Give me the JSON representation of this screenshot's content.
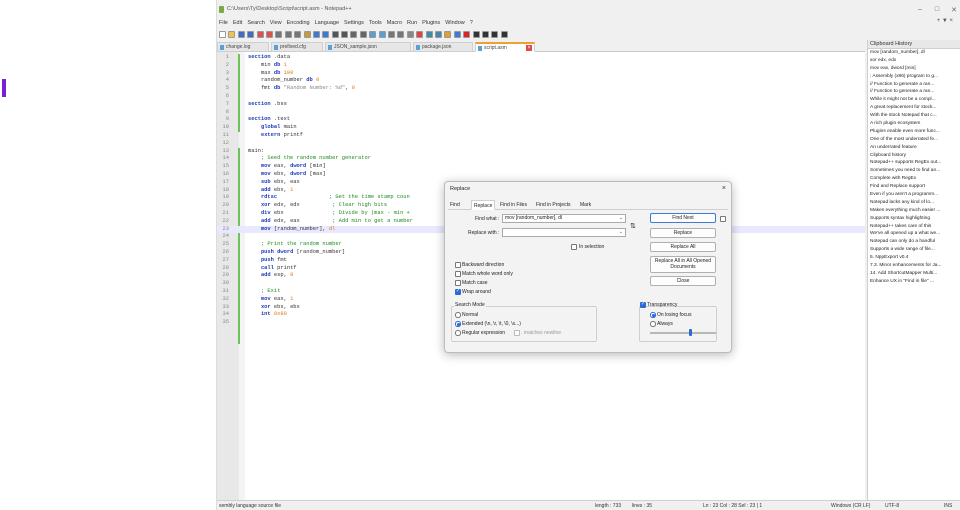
{
  "window": {
    "title": "C:\\Users\\Ty\\Desktop\\Script\\script.asm - Notepad++"
  },
  "menu": [
    "File",
    "Edit",
    "Search",
    "View",
    "Encoding",
    "Language",
    "Settings",
    "Tools",
    "Macro",
    "Run",
    "Plugins",
    "Window",
    "?"
  ],
  "menu_right": "+ ▼ ×",
  "toolbar_icons": [
    "new-icon",
    "open-icon",
    "save-icon",
    "save-all-icon",
    "close-icon",
    "close-all-icon",
    "print-icon",
    "cut-icon",
    "copy-icon",
    "paste-icon",
    "undo-icon",
    "redo-icon",
    "find-icon",
    "replace-icon",
    "zoom-in-icon",
    "zoom-out-icon",
    "sync-v-icon",
    "sync-h-icon",
    "wrap-icon",
    "all-chars-icon",
    "indent-guide-icon",
    "udl-icon",
    "doc-map-icon",
    "func-list-icon",
    "folder-icon",
    "monitor-icon",
    "record-icon",
    "stop-icon",
    "play-icon",
    "play-multi-icon",
    "save-macro-icon"
  ],
  "tabs": [
    {
      "label": "change.log"
    },
    {
      "label": "prefixed.cfg"
    },
    {
      "label": "JSON_sample.json"
    },
    {
      "label": "package.json"
    },
    {
      "label": "script.asm",
      "close": "×"
    }
  ],
  "code_lines": [
    {
      "n": "1",
      "t": [
        {
          "c": "kw",
          "v": "section"
        },
        {
          "c": "id",
          "v": " .data"
        }
      ]
    },
    {
      "n": "2",
      "t": [
        {
          "c": "id",
          "v": "    min "
        },
        {
          "c": "kw",
          "v": "db"
        },
        {
          "c": "num",
          "v": " 1"
        }
      ]
    },
    {
      "n": "3",
      "t": [
        {
          "c": "id",
          "v": "    max "
        },
        {
          "c": "kw",
          "v": "db"
        },
        {
          "c": "num",
          "v": " 100"
        }
      ]
    },
    {
      "n": "4",
      "t": [
        {
          "c": "id",
          "v": "    random_number "
        },
        {
          "c": "kw",
          "v": "db"
        },
        {
          "c": "num",
          "v": " 0"
        }
      ]
    },
    {
      "n": "5",
      "t": [
        {
          "c": "id",
          "v": "    fmt "
        },
        {
          "c": "kw",
          "v": "db"
        },
        {
          "c": "str",
          "v": " \"Random Number: %d\""
        },
        {
          "c": "id",
          "v": ", "
        },
        {
          "c": "num",
          "v": "0"
        }
      ]
    },
    {
      "n": "6",
      "t": []
    },
    {
      "n": "7",
      "t": [
        {
          "c": "kw",
          "v": "section"
        },
        {
          "c": "id",
          "v": " .bss"
        }
      ]
    },
    {
      "n": "8",
      "t": []
    },
    {
      "n": "9",
      "t": [
        {
          "c": "kw",
          "v": "section"
        },
        {
          "c": "id",
          "v": " .text"
        }
      ]
    },
    {
      "n": "10",
      "t": [
        {
          "c": "id",
          "v": "    "
        },
        {
          "c": "kw",
          "v": "global"
        },
        {
          "c": "id",
          "v": " main"
        }
      ]
    },
    {
      "n": "11",
      "t": [
        {
          "c": "id",
          "v": "    "
        },
        {
          "c": "kw",
          "v": "extern"
        },
        {
          "c": "id",
          "v": " printf"
        }
      ]
    },
    {
      "n": "12",
      "t": []
    },
    {
      "n": "13",
      "t": [
        {
          "c": "lbl",
          "v": "main:"
        }
      ]
    },
    {
      "n": "14",
      "t": [
        {
          "c": "cmt",
          "v": "    ; Seed the random number generator"
        }
      ]
    },
    {
      "n": "15",
      "t": [
        {
          "c": "ins",
          "v": "    mov"
        },
        {
          "c": "id",
          "v": " eax, "
        },
        {
          "c": "ins",
          "v": "dword"
        },
        {
          "c": "id",
          "v": " [min]"
        }
      ]
    },
    {
      "n": "16",
      "t": [
        {
          "c": "ins",
          "v": "    mov"
        },
        {
          "c": "id",
          "v": " ebx, "
        },
        {
          "c": "ins",
          "v": "dword"
        },
        {
          "c": "id",
          "v": " [max]"
        }
      ]
    },
    {
      "n": "17",
      "t": [
        {
          "c": "ins",
          "v": "    sub"
        },
        {
          "c": "id",
          "v": " ebx, eax"
        }
      ]
    },
    {
      "n": "18",
      "t": [
        {
          "c": "ins",
          "v": "    add"
        },
        {
          "c": "id",
          "v": " ebx, "
        },
        {
          "c": "num",
          "v": "1"
        }
      ]
    },
    {
      "n": "19",
      "t": [
        {
          "c": "ins",
          "v": "    rdtsc"
        },
        {
          "c": "cmt",
          "v": "                ; Get the time stamp coun"
        }
      ]
    },
    {
      "n": "20",
      "t": [
        {
          "c": "ins",
          "v": "    xor"
        },
        {
          "c": "id",
          "v": " edx, edx"
        },
        {
          "c": "cmt",
          "v": "          ; Clear high bits"
        }
      ]
    },
    {
      "n": "21",
      "t": [
        {
          "c": "ins",
          "v": "    div"
        },
        {
          "c": "id",
          "v": " ebx"
        },
        {
          "c": "cmt",
          "v": "               ; Divide by (max - min +"
        }
      ]
    },
    {
      "n": "22",
      "t": [
        {
          "c": "ins",
          "v": "    add"
        },
        {
          "c": "id",
          "v": " edx, eax"
        },
        {
          "c": "cmt",
          "v": "          ; Add min to get a number"
        }
      ]
    },
    {
      "n": "23",
      "hl": true,
      "t": [
        {
          "c": "ins",
          "v": "    mov"
        },
        {
          "c": "id",
          "v": " [random_number], "
        },
        {
          "c": "num",
          "v": "dl"
        }
      ]
    },
    {
      "n": "24",
      "t": []
    },
    {
      "n": "25",
      "t": [
        {
          "c": "cmt",
          "v": "    ; Print the random number"
        }
      ]
    },
    {
      "n": "26",
      "t": [
        {
          "c": "ins",
          "v": "    push"
        },
        {
          "c": "ins",
          "v": " dword"
        },
        {
          "c": "id",
          "v": " [random_number]"
        }
      ]
    },
    {
      "n": "27",
      "t": [
        {
          "c": "ins",
          "v": "    push"
        },
        {
          "c": "id",
          "v": " fmt"
        }
      ]
    },
    {
      "n": "28",
      "t": [
        {
          "c": "ins",
          "v": "    call"
        },
        {
          "c": "id",
          "v": " printf"
        }
      ]
    },
    {
      "n": "29",
      "t": [
        {
          "c": "ins",
          "v": "    add"
        },
        {
          "c": "id",
          "v": " esp, "
        },
        {
          "c": "num",
          "v": "8"
        }
      ]
    },
    {
      "n": "30",
      "t": []
    },
    {
      "n": "31",
      "t": [
        {
          "c": "cmt",
          "v": "    ; Exit"
        }
      ]
    },
    {
      "n": "32",
      "t": [
        {
          "c": "ins",
          "v": "    mov"
        },
        {
          "c": "id",
          "v": " eax, "
        },
        {
          "c": "num",
          "v": "1"
        }
      ]
    },
    {
      "n": "33",
      "t": [
        {
          "c": "ins",
          "v": "    xor"
        },
        {
          "c": "id",
          "v": " ebx, ebx"
        }
      ]
    },
    {
      "n": "34",
      "t": [
        {
          "c": "ins",
          "v": "    int"
        },
        {
          "c": "num",
          "v": " 0x80"
        }
      ]
    },
    {
      "n": "35",
      "t": []
    }
  ],
  "clipboard": {
    "title": "Clipboard History",
    "items": [
      "mov [random_number], dl",
      "xor edx, edx",
      "mov eax, dword [min]",
      "; Assembly (x86) program to g...",
      "// Function to generate a ran...",
      "// Function to generate a ran...",
      "While it might not be a compl...",
      "A great replacement for stock...",
      "With the stock Notepad that c...",
      "A rich plugin ecosystem",
      "Plugins enable even more func...",
      "One of the most underrated fe...",
      "An underrated feature",
      "Clipboard history",
      "Notepad++ supports RegEx out...",
      "Sometimes you need to find an...",
      "Complete with RegEx",
      "Find and Replace support",
      "Even if you aren't a programm...",
      "Notepad lacks any kind of lo...",
      "Makes everything much easier ...",
      "Supports syntax highlighting",
      "Notepad++ takes care of this",
      "We've all opened up a what we...",
      "Notepad can only do a handful",
      "Supports a wide range of file...",
      "5.  NppExport v0.4",
      "7.3. Minor enhancements for Ja...",
      "14. Add ShortcutMapper Multi...",
      "Enhance UX in \"Find in file\" ..."
    ]
  },
  "status": {
    "left": "sembly language source file",
    "length": "length : 733",
    "lines": "lines : 35",
    "pos": "Ln : 23    Col : 28    Sel : 23 | 1",
    "eol": "Windows (CR LF)",
    "enc": "UTF-8",
    "mode": "INS"
  },
  "dialog": {
    "title": "Replace",
    "close": "×",
    "tabs": [
      "Find",
      "Replace",
      "Find in Files",
      "Find in Projects",
      "Mark"
    ],
    "find_label": "Find what :",
    "find_value": "mov [random_number], dl",
    "replace_label": "Replace with :",
    "replace_value": "",
    "in_selection": "In selection",
    "swap": "⇅",
    "buttons": {
      "find_next": "Find Next",
      "replace": "Replace",
      "replace_all": "Replace All",
      "replace_all_docs": "Replace All in All Opened Documents",
      "close": "Close"
    },
    "options": {
      "backward": "Backward direction",
      "whole_word": "Match whole word only",
      "match_case": "Match case",
      "wrap": "Wrap around"
    },
    "search_mode": {
      "label": "Search Mode",
      "normal": "Normal",
      "extended": "Extended (\\n, \\r, \\t, \\0, \\x...)",
      "regex": "Regular expression",
      "matches_newline": ". matches newline"
    },
    "transparency": {
      "label": "Transparency",
      "on_losing_focus": "On losing focus",
      "always": "Always",
      "level": 0.62
    }
  }
}
